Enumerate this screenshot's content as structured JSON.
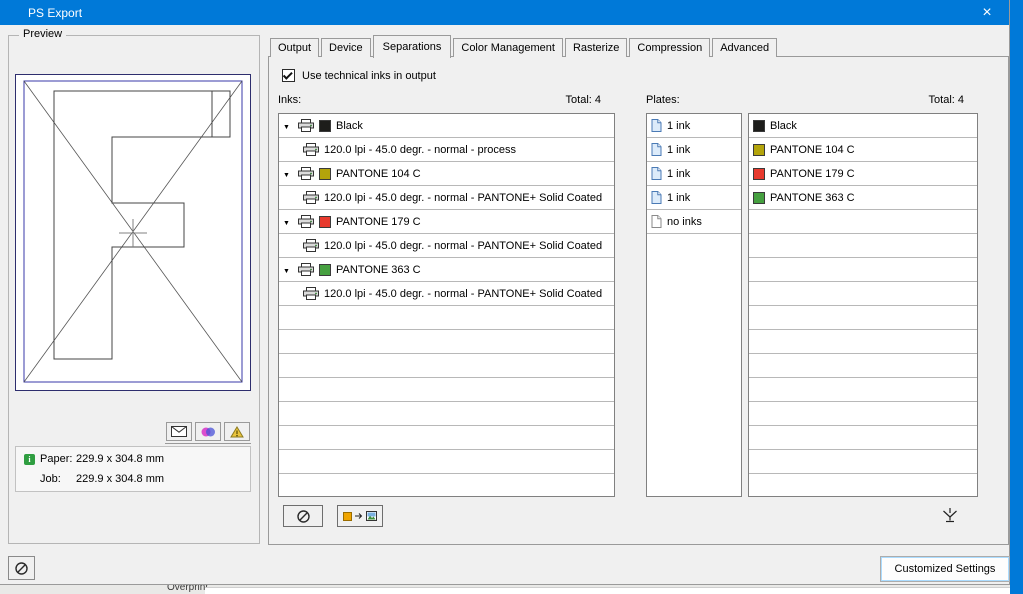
{
  "window": {
    "title": "PS Export",
    "close_glyph": "×"
  },
  "preview": {
    "group_label": "Preview",
    "paper_label": "Paper:",
    "paper_value": "229.9 x 304.8 mm",
    "job_label": "Job:",
    "job_value": "229.9 x 304.8 mm"
  },
  "tabs": [
    {
      "label": "Output"
    },
    {
      "label": "Device"
    },
    {
      "label": "Separations"
    },
    {
      "label": "Color Management"
    },
    {
      "label": "Rasterize"
    },
    {
      "label": "Compression"
    },
    {
      "label": "Advanced"
    }
  ],
  "separations_tab": {
    "checkbox_label": "Use technical inks in output",
    "inks_label": "Inks:",
    "inks_total": "Total: 4",
    "plates_label": "Plates:",
    "plates_total": "Total: 4",
    "inks": [
      {
        "name": "Black",
        "color": "#1d1d1b",
        "screening": "120.0 lpi - 45.0 degr. - normal - process"
      },
      {
        "name": "PANTONE 104 C",
        "color": "#b3a40b",
        "screening": "120.0 lpi - 45.0 degr. - normal - PANTONE+ Solid Coated"
      },
      {
        "name": "PANTONE 179 C",
        "color": "#e83a2e",
        "screening": "120.0 lpi - 45.0 degr. - normal - PANTONE+ Solid Coated"
      },
      {
        "name": "PANTONE 363 C",
        "color": "#46a040",
        "screening": "120.0 lpi - 45.0 degr. - normal - PANTONE+ Solid Coated"
      }
    ],
    "plates": [
      {
        "count": "1 ink",
        "name": "Black",
        "color": "#1d1d1b"
      },
      {
        "count": "1 ink",
        "name": "PANTONE 104 C",
        "color": "#b3a40b"
      },
      {
        "count": "1 ink",
        "name": "PANTONE 179 C",
        "color": "#e83a2e"
      },
      {
        "count": "1 ink",
        "name": "PANTONE 363 C",
        "color": "#46a040"
      }
    ],
    "empty_plate_label": "no inks"
  },
  "footer": {
    "customized_settings": "Customized Settings"
  },
  "background_window": {
    "overprint_label": "Overprint"
  }
}
